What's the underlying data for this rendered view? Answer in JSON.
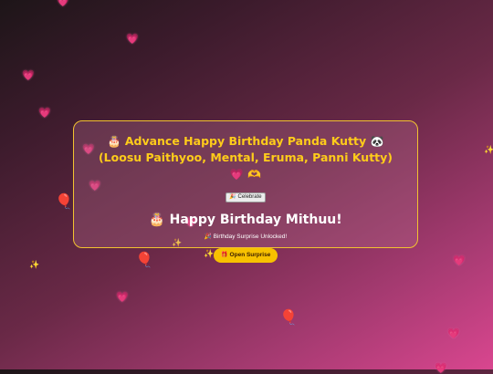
{
  "card": {
    "title_prefix": "🎂",
    "title_main": "Advance Happy Birthday Panda Kutty",
    "title_panda": "🐼",
    "title_rest": "(Loosu Paithyoo, Mental, Eruma, Panni Kutty)",
    "title_heart": "💗",
    "title_hands": "🫶",
    "celebrate_button": "🎉 Celebrate",
    "greeting_icon": "🎂",
    "greeting": "Happy Birthday Mithuu!",
    "unlocked_icon": "🎉",
    "unlocked_text": "Birthday Surprise Unlocked!",
    "open_button_icon": "🎁",
    "open_button_label": "Open Surprise"
  },
  "decorations": {
    "heart": "💗",
    "sparkle": "✨",
    "balloon": "🎈"
  },
  "colors": {
    "accent_yellow": "#f7c100",
    "title_yellow": "#ffcc1a",
    "heart_pink": "#ff7fb4",
    "border": "#f2c230"
  }
}
